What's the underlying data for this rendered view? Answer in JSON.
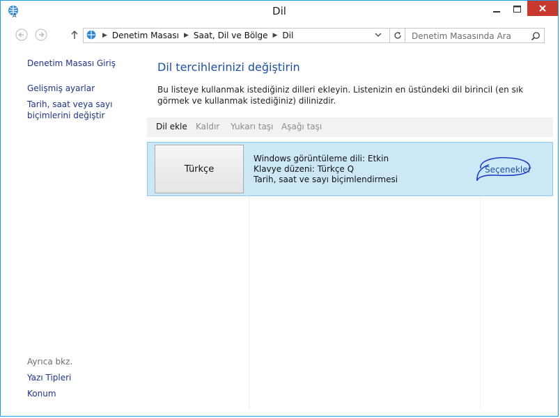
{
  "window": {
    "title": "Dil"
  },
  "address_bar": {
    "crumbs": [
      "Denetim Masası",
      "Saat, Dil ve Bölge",
      "Dil"
    ],
    "search_placeholder": "Denetim Masasında Ara"
  },
  "sidebar": {
    "links": [
      "Denetim Masası Giriş",
      "Gelişmiş ayarlar",
      "Tarih, saat veya sayı biçimlerini değiştir"
    ],
    "see_also_header": "Ayrıca bkz.",
    "see_also_links": [
      "Yazı Tipleri",
      "Konum"
    ]
  },
  "main": {
    "title": "Dil tercihlerinizi değiştirin",
    "description": "Bu listeye kullanmak istediğiniz dilleri ekleyin. Listenizin en üstündeki dil birincil (en sık görmek ve kullanmak istediğiniz) dilinizdir.",
    "toolbar": [
      "Dil ekle",
      "Kaldır",
      "Yukarı taşı",
      "Aşağı taşı"
    ],
    "languages": [
      {
        "name": "Türkçe",
        "details": [
          "Windows görüntüleme dili: Etkin",
          "Klavye düzeni: Türkçe Q",
          "Tarih, saat ve sayı biçimlendirmesi"
        ],
        "options_label": "Seçenekler"
      }
    ]
  },
  "colors": {
    "accent_border": "#1d9ce5",
    "link": "#1e3287",
    "heading": "#1e50a0",
    "selected_row": "#cce8f6",
    "close_button": "#c7392f"
  },
  "icons": [
    "control-panel-icon",
    "minimize-icon",
    "maximize-icon",
    "close-icon",
    "back-arrow-icon",
    "forward-arrow-icon",
    "up-arrow-icon",
    "chevron-right-icon",
    "chevron-down-icon",
    "refresh-icon",
    "search-icon"
  ]
}
